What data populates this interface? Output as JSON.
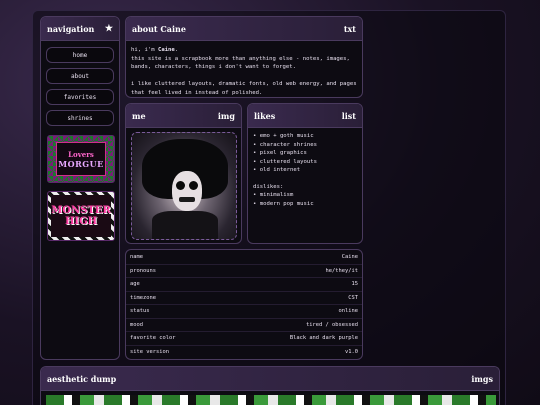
{
  "nav": {
    "title": "navigation",
    "star": "★",
    "items": [
      "home",
      "about",
      "favorites",
      "shrines"
    ],
    "badges": [
      {
        "lines": [
          "Lovers",
          "MORGUE"
        ]
      },
      {
        "lines": [
          "MONSTER",
          "HIGH"
        ]
      }
    ]
  },
  "about": {
    "title": "about Caine",
    "tag": "txt",
    "greeting_prefix": "hi, i'm ",
    "greeting_name": "Caine",
    "greeting_suffix": ".",
    "line2": "this site is a scrapbook more than anything else - notes, images,",
    "line3": "bands, characters, things i don't want to forget.",
    "line4": "i like cluttered layouts, dramatic fonts, old web energy, and pages",
    "line5": "that feel lived in instead of polished."
  },
  "me": {
    "title": "me",
    "tag": "img"
  },
  "likes": {
    "title": "likes",
    "tag": "list",
    "items": [
      "• emo + goth music",
      "• character shrines",
      "• pixel graphics",
      "• cluttered layouts",
      "• old internet"
    ],
    "dislikes_label": "dislikes:",
    "dislikes": [
      "• minimalism",
      "• modern pop music"
    ]
  },
  "info": {
    "rows": [
      {
        "k": "name",
        "v": "Caine"
      },
      {
        "k": "pronouns",
        "v": "he/they/it"
      },
      {
        "k": "age",
        "v": "15"
      },
      {
        "k": "timezone",
        "v": "CST"
      },
      {
        "k": "status",
        "v": "online"
      },
      {
        "k": "mood",
        "v": "tired / obsessed"
      },
      {
        "k": "favorite color",
        "v": "Black and dark purple"
      },
      {
        "k": "site version",
        "v": "v1.0"
      }
    ]
  },
  "dump": {
    "title": "aesthetic dump",
    "tag": "imgs"
  },
  "colors": {
    "accent": "#3a2a4e",
    "border": "#4a3a5e",
    "bg": "#0d0b12"
  }
}
